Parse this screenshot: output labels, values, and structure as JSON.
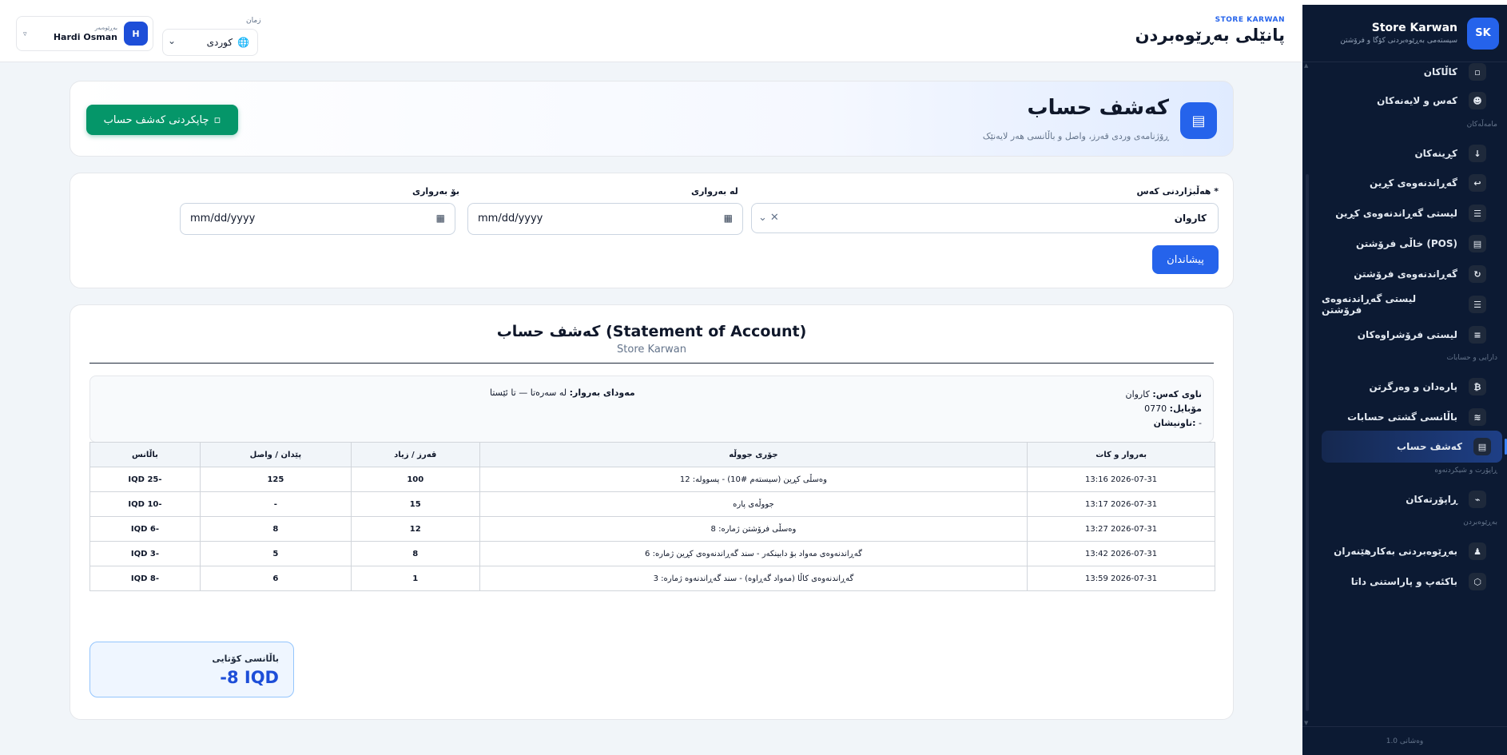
{
  "app": {
    "brand_name": "Store Karwan",
    "brand_sub": "سیستەمی بەڕێوەبردنی کۆگا و فرۆشتن",
    "logo": "SK",
    "version": "وەشانی 1.0"
  },
  "topbar": {
    "brand": "STORE KARWAN",
    "title": "پانێلی بەڕێوەبردن",
    "language_label": "زمان",
    "language_value": "کوردی",
    "user_role": "بەڕێوەبەر",
    "user_name": "Hardi Osman",
    "user_initial": "H"
  },
  "sidebar": {
    "items_top": [
      {
        "label": "کاڵاکان",
        "icon": "box-icon",
        "glyph": "▫"
      },
      {
        "label": "کەس و لایەنەکان",
        "icon": "person-icon",
        "glyph": "☻"
      }
    ],
    "section_1": "مامەڵەکان",
    "items_1": [
      {
        "label": "کڕینەکان",
        "icon": "download-icon",
        "glyph": "↓"
      },
      {
        "label": "گەڕاندنەوەی کڕین",
        "icon": "return-icon",
        "glyph": "↩"
      },
      {
        "label": "لیستی گەڕاندنەوەی کڕین",
        "icon": "list-icon",
        "glyph": "☰"
      },
      {
        "label": "خاڵی فرۆشتن (POS)",
        "icon": "pos-icon",
        "glyph": "▤"
      },
      {
        "label": "گەڕاندنەوەی فرۆشتن",
        "icon": "rotate-icon",
        "glyph": "↻"
      },
      {
        "label": "لیستی گەڕاندنەوەی فرۆشتن",
        "icon": "list-icon",
        "glyph": "☰"
      },
      {
        "label": "لیستی فرۆشراوەکان",
        "icon": "lines-icon",
        "glyph": "≡"
      }
    ],
    "section_2": "دارایی و حسابات",
    "items_2": [
      {
        "label": "پارەدان و وەرگرتن",
        "icon": "bitcoin-icon",
        "glyph": "₿"
      },
      {
        "label": "باڵانسی گشتی حسابات",
        "icon": "balance-icon",
        "glyph": "≋"
      },
      {
        "label": "کەشف حساب",
        "icon": "statement-icon",
        "glyph": "▤"
      }
    ],
    "section_3": "ڕاپۆرت و شیکردنەوە",
    "items_3": [
      {
        "label": "ڕاپۆرتەکان",
        "icon": "chart-icon",
        "glyph": "⌁"
      }
    ],
    "section_4": "بەڕێوەبردن",
    "items_4": [
      {
        "label": "بەڕێوەبردنی بەکارهێنەران",
        "icon": "user-icon",
        "glyph": "♟"
      },
      {
        "label": "باکئەپ و پاراستنی داتا",
        "icon": "shield-icon",
        "glyph": "⬡"
      }
    ]
  },
  "page": {
    "title": "کەشف حساب",
    "subtitle": "ڕۆژنامەی وردی قەرز، واصل و باڵانسی هەر لایەنێک",
    "print_button": "چاپکردنی کەشف حساب"
  },
  "filters": {
    "person_label": "هەڵبژاردنی کەس *",
    "person_value": "کاروان",
    "from_label": "لە بەرواری",
    "to_label": "بۆ بەرواری",
    "from_value": "mm/dd/yyyy",
    "to_value": "mm/dd/yyyy",
    "show_button": "پیشاندان"
  },
  "report": {
    "title": "کەشف حساب (Statement of Account)",
    "store": "Store Karwan",
    "name_label": "ناوی کەس:",
    "name_value": "کاروان",
    "mobile_label": "مۆبایل:",
    "mobile_value": "0770",
    "address_label": "ناونیشان:",
    "address_value": "-",
    "period_label": "مەودای بەروار:",
    "period_value": "لە سەرەتا — تا ئێستا",
    "columns": [
      "بەروار و کات",
      "جۆری جووڵە",
      "قەرز / زیاد",
      "پێدان / واصل",
      "باڵانس"
    ],
    "rows": [
      [
        "2026-07-31 13:16",
        "وەسڵی کڕین (سیستەم #10) - پسوولە: 12",
        "100",
        "125",
        "-25 IQD"
      ],
      [
        "2026-07-31 13:17",
        "جووڵەی پارە",
        "15",
        "-",
        "-10 IQD"
      ],
      [
        "2026-07-31 13:27",
        "وەسڵی فرۆشتن ژمارە: 8",
        "12",
        "8",
        "-6 IQD"
      ],
      [
        "2026-07-31 13:42",
        "گەڕاندنەوەی مەواد بۆ دابینکەر - سند گەڕاندنەوەی کڕین ژمارە: 6",
        "8",
        "5",
        "-3 IQD"
      ],
      [
        "2026-07-31 13:59",
        "گەڕاندنەوەی کاڵا (مەواد گەڕاوە) - سند گەڕاندنەوە ژمارە: 3",
        "1",
        "6",
        "-8 IQD"
      ]
    ],
    "final_label": "باڵانسی کۆتایی",
    "final_value": "-8 IQD"
  },
  "colors": {
    "accent": "#2563eb",
    "success": "#059669",
    "danger": "#dc2626",
    "sidebar_bg": "#0c1a33"
  }
}
